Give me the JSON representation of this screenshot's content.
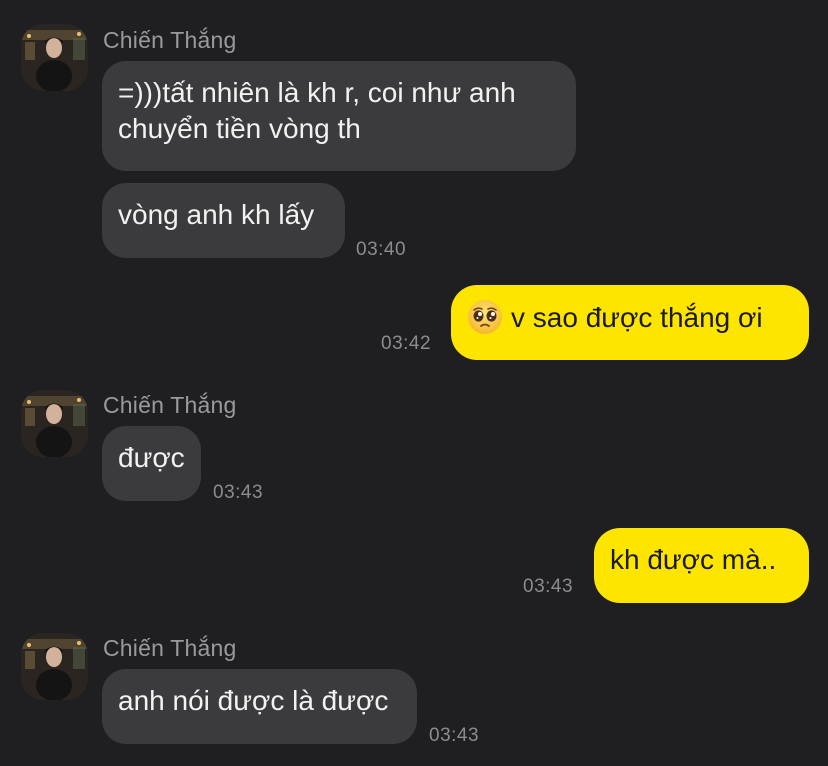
{
  "colors": {
    "background": "#1f1f21",
    "incoming_bubble": "#3b3b3d",
    "outgoing_bubble": "#fee500",
    "sender_name": "#9a9a9c",
    "timestamp": "#8c8c8e"
  },
  "messages": [
    {
      "sender": "Chiến Thắng",
      "bubbles": [
        {
          "line1": "=)))tất nhiên là kh r, coi như anh",
          "line2": "chuyển tiền vòng th"
        },
        {
          "text": "vòng anh kh lấy",
          "time": "03:40"
        }
      ]
    },
    {
      "outgoing": true,
      "emoji": "pleading-face-icon",
      "text": "v sao được thắng ơi",
      "time": "03:42"
    },
    {
      "sender": "Chiến Thắng",
      "text": "được",
      "time": "03:43"
    },
    {
      "outgoing": true,
      "text": "kh được mà..",
      "time": "03:43"
    },
    {
      "sender": "Chiến Thắng",
      "text": "anh nói được là được",
      "time": "03:43"
    }
  ]
}
